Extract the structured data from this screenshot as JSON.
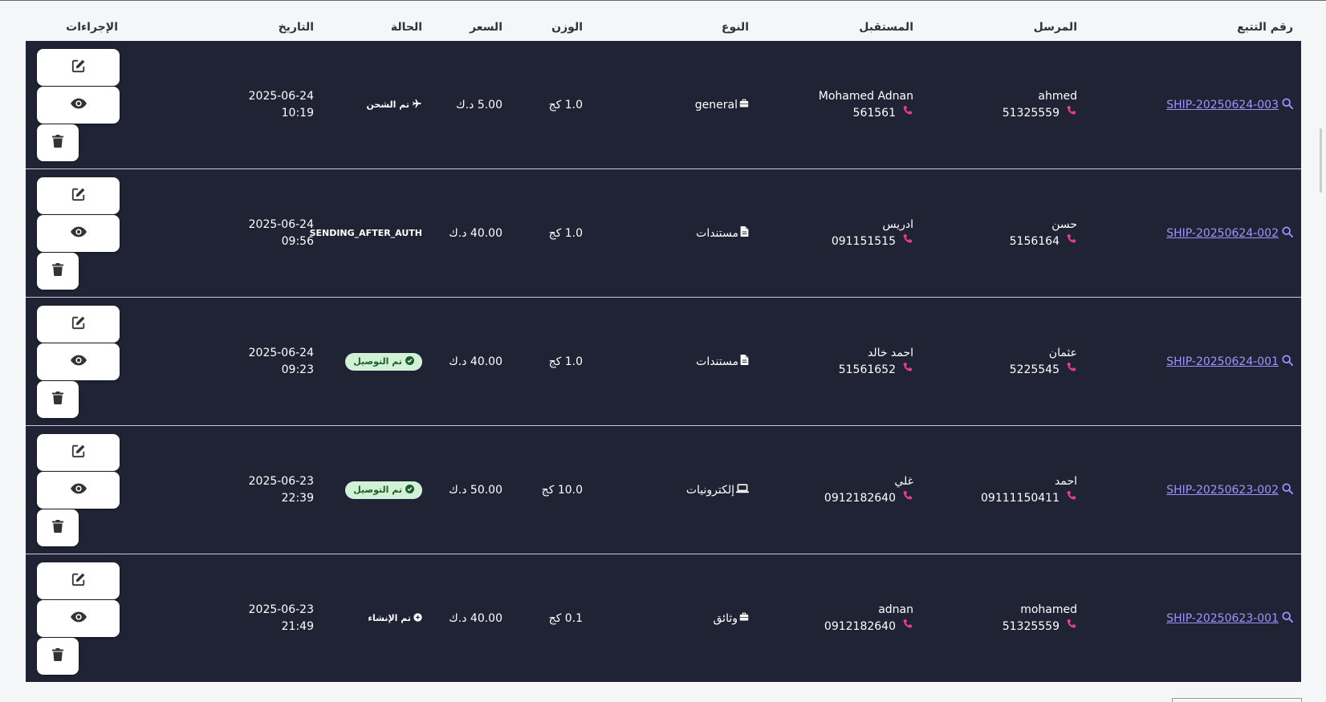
{
  "table": {
    "headers": {
      "tracking": "رقم التتبع",
      "sender": "المرسل",
      "receiver": "المستقبل",
      "type": "النوع",
      "weight": "الوزن",
      "price": "السعر",
      "status": "الحالة",
      "date": "التاريخ",
      "actions": "الإجراءات"
    },
    "rows": [
      {
        "tracking": "SHIP-20250624-003",
        "sender_name": "ahmed",
        "sender_phone": "51325559",
        "receiver_name": "Mohamed Adnan",
        "receiver_phone": "561561",
        "type": "general",
        "type_icon": "briefcase-icon",
        "weight": "1.0 كج",
        "price": "5.00 د.ك",
        "status": "تم الشحن",
        "status_style": "plain",
        "status_icon": "plane-icon",
        "date": "2025-06-24",
        "time": "10:19"
      },
      {
        "tracking": "SHIP-20250624-002",
        "sender_name": "حسن",
        "sender_phone": "5156164",
        "receiver_name": "ادريس",
        "receiver_phone": "091151515",
        "type": "مستندات",
        "type_icon": "file-icon",
        "weight": "1.0 كج",
        "price": "40.00 د.ك",
        "status": "SENDING_AFTER_AUTH",
        "status_style": "plain",
        "status_icon": "",
        "date": "2025-06-24",
        "time": "09:56"
      },
      {
        "tracking": "SHIP-20250624-001",
        "sender_name": "عثمان",
        "sender_phone": "5225545",
        "receiver_name": "احمد خالد",
        "receiver_phone": "51561652",
        "type": "مستندات",
        "type_icon": "file-icon",
        "weight": "1.0 كج",
        "price": "40.00 د.ك",
        "status": "تم التوصيل",
        "status_style": "badge",
        "status_icon": "check-circle-icon",
        "date": "2025-06-24",
        "time": "09:23"
      },
      {
        "tracking": "SHIP-20250623-002",
        "sender_name": "احمد",
        "sender_phone": "09111150411",
        "receiver_name": "غلي",
        "receiver_phone": "0912182640",
        "type": "إلكترونيات",
        "type_icon": "laptop-icon",
        "weight": "10.0 كج",
        "price": "50.00 د.ك",
        "status": "تم التوصيل",
        "status_style": "badge",
        "status_icon": "check-circle-icon",
        "date": "2025-06-23",
        "time": "22:39"
      },
      {
        "tracking": "SHIP-20250623-001",
        "sender_name": "mohamed",
        "sender_phone": "51325559",
        "receiver_name": "adnan",
        "receiver_phone": "0912182640",
        "type": "وثائق",
        "type_icon": "briefcase-icon",
        "weight": "0.1 كج",
        "price": "40.00 د.ك",
        "status": "تم الإنشاء",
        "status_style": "plain",
        "status_icon": "plus-circle-icon",
        "date": "2025-06-23",
        "time": "21:49"
      }
    ]
  },
  "colors": {
    "row_bg": "#1f2334",
    "link": "#9f94ff",
    "phone_icon": "#e83e8c",
    "badge_bg": "#d1f2d6"
  },
  "actions": {
    "edit_icon": "edit-icon",
    "view_icon": "eye-icon",
    "delete_icon": "trash-icon"
  }
}
